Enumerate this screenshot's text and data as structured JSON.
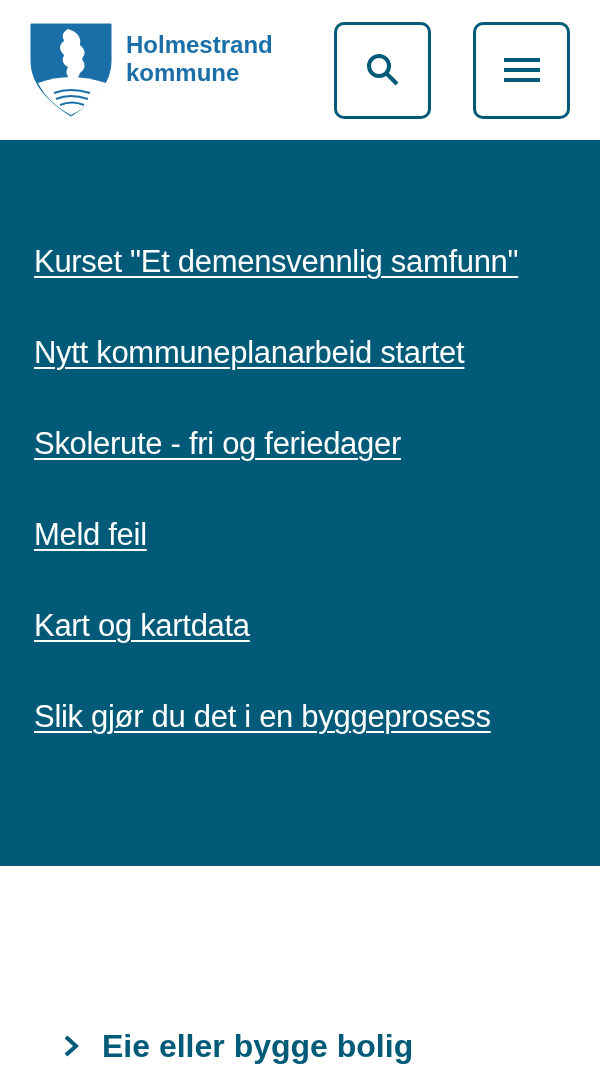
{
  "header": {
    "logo_text": [
      "Holmestrand",
      "kommune"
    ]
  },
  "links": [
    "Kurset \"Et demensvennlig samfunn\"",
    "Nytt kommuneplanarbeid startet",
    "Skolerute - fri og feriedager",
    "Meld feil",
    "Kart og kartdata",
    "Slik gjør du det i en byggeprosess"
  ],
  "topics": [
    {
      "label": "Eie eller bygge bolig",
      "expanded": false
    }
  ]
}
